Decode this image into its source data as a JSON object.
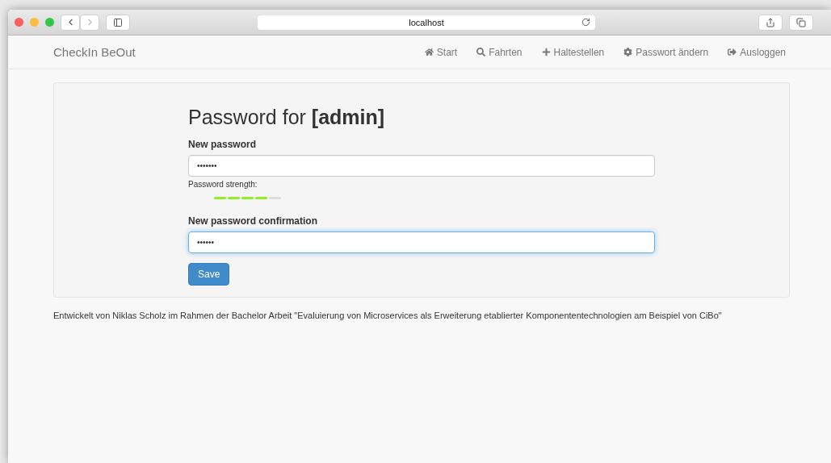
{
  "browser": {
    "address": "localhost"
  },
  "navbar": {
    "brand": "CheckIn BeOut",
    "items": [
      {
        "label": "Start"
      },
      {
        "label": "Fahrten"
      },
      {
        "label": "Haltestellen"
      },
      {
        "label": "Passwort ändern"
      },
      {
        "label": "Ausloggen"
      }
    ]
  },
  "form": {
    "title": "Password for **[admin]**",
    "fields": [
      {
        "label": "New password",
        "value": "•••••••",
        "focused": false,
        "strength": {
          "label": "Password strength:",
          "level": 0.8
        }
      },
      {
        "label": "New password confirmation",
        "value": "••••••",
        "focused": true
      }
    ],
    "button": "Save"
  },
  "footer": "Entwickelt von Niklas Scholz im Rahmen der Bachelor Arbeit \"Evaluierung von Microservices als Erweiterung etablierter Komponententechnologien am Beispiel von CiBo\""
}
